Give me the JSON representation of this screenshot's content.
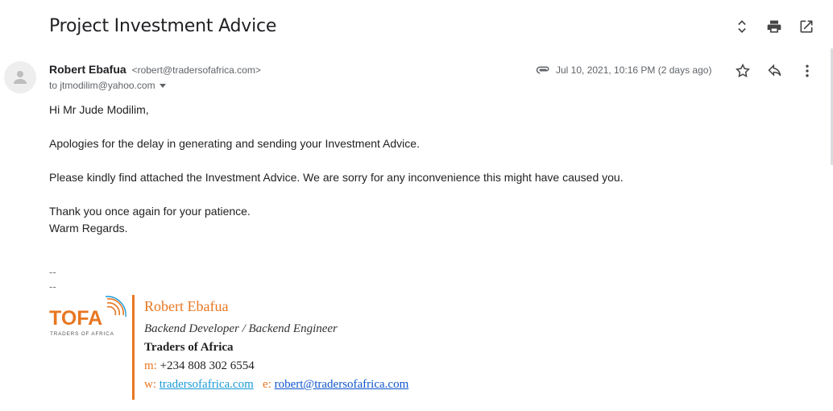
{
  "subject": "Project Investment Advice",
  "sender": {
    "name": "Robert Ebafua",
    "email": "<robert@tradersofafrica.com>",
    "to": "to jtmodilim@yahoo.com"
  },
  "meta": {
    "date": "Jul 10, 2021, 10:16 PM (2 days ago)"
  },
  "body": {
    "greeting": "Hi  Mr Jude Modilim,",
    "p1": "Apologies for the delay in generating and sending your Investment Advice.",
    "p2": "Please kindly find attached the Investment Advice. We are sorry for any inconvenience this might have caused you.",
    "p3a": "Thank you once again for your patience.",
    "p3b": "Warm Regards."
  },
  "signature": {
    "dash1": "--",
    "dash2": "--",
    "logo_text": "TOFA",
    "logo_sub": "TRADERS OF AFRICA",
    "name": "Robert Ebafua",
    "title": "Backend Developer / Backend Engineer",
    "company": "Traders of Africa",
    "phone_label": "m:",
    "phone": "+234 808 302 6554",
    "web_label": "w:",
    "web": "tradersofafrica.com",
    "email_label": "e:",
    "email": "robert@tradersofafrica.com"
  },
  "colors": {
    "accent": "#e87722",
    "link_web": "#1a9bd7",
    "link_mail": "#1155cc"
  },
  "icons": [
    "expand-collapse-icon",
    "print-icon",
    "open-in-new-icon",
    "avatar-person-icon",
    "attachment-icon",
    "star-icon",
    "reply-icon",
    "more-vert-icon"
  ]
}
